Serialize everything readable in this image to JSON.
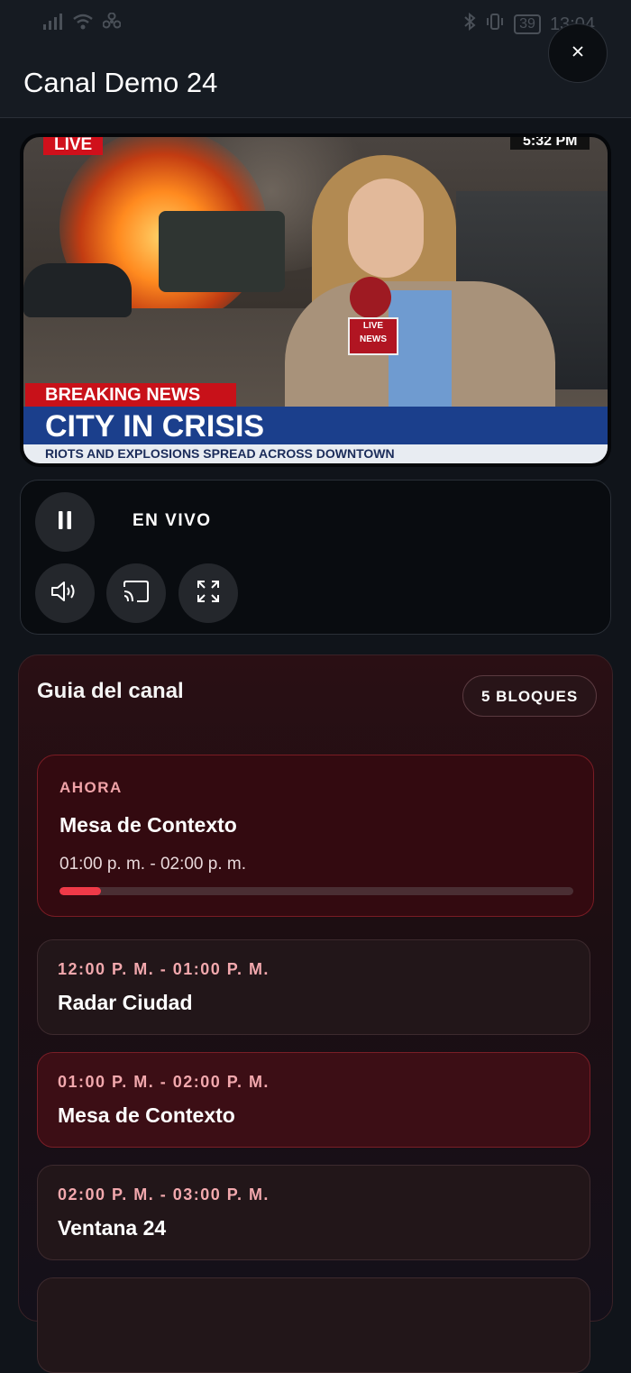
{
  "status_bar": {
    "battery": "39",
    "time": "13:04"
  },
  "header": {
    "title": "Canal Demo 24"
  },
  "video": {
    "live_tag": "LIVE",
    "time_tag": "5:32 PM",
    "mic_text": "LIVE NEWS",
    "breaking": "BREAKING NEWS",
    "headline": "CITY IN CRISIS",
    "ticker": "RIOTS AND EXPLOSIONS SPREAD ACROSS DOWNTOWN"
  },
  "player": {
    "status": "EN VIVO"
  },
  "guide": {
    "title": "Guia del canal",
    "blocks_badge": "5 BLOQUES",
    "now": {
      "label": "AHORA",
      "title": "Mesa de Contexto",
      "time": "01:00 p. m. - 02:00 p. m.",
      "progress": 0.08
    },
    "slots": [
      {
        "time": "12:00 P. M. - 01:00 P. M.",
        "title": "Radar Ciudad",
        "active": false
      },
      {
        "time": "01:00 P. M. - 02:00 P. M.",
        "title": "Mesa de Contexto",
        "active": true
      },
      {
        "time": "02:00 P. M. - 03:00 P. M.",
        "title": "Ventana 24",
        "active": false
      }
    ]
  }
}
